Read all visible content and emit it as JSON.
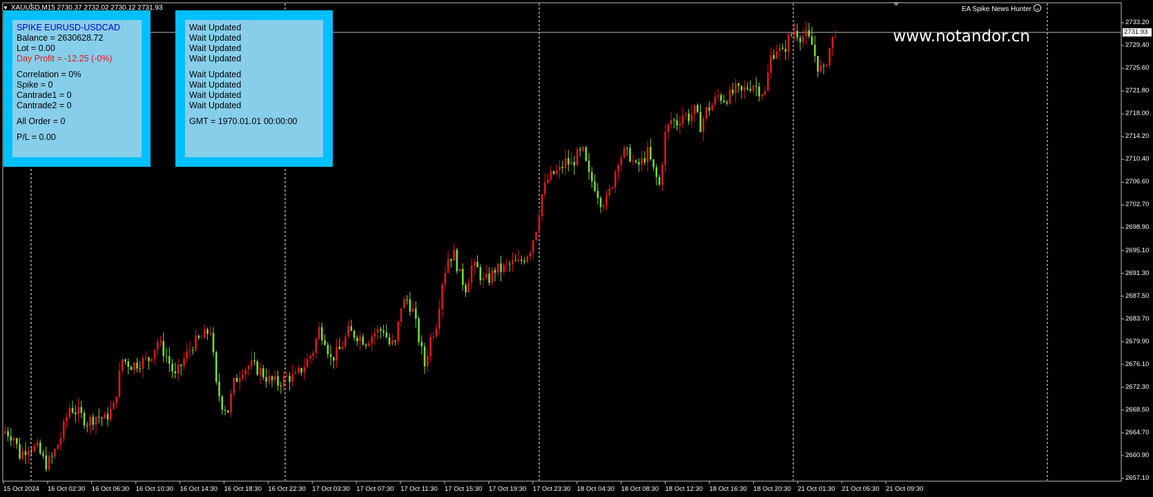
{
  "header": {
    "symbol_ohlc": "XAUUSD,M15  2730.37 2732.02 2730.12 2731.93",
    "ea_name": "EA Spike News Hunter",
    "watermark": "www.notandor.cn"
  },
  "colors": {
    "bull": "#E0171B",
    "bear": "#7BD83A",
    "panel_border": "#00BFFF",
    "panel_fill": "#87CEEB",
    "title_blue": "#0000CD",
    "profit_red": "#E0171B"
  },
  "panel_left": {
    "title": "SPIKE EURUSD-USDCAD",
    "balance": "Balance = 2630628.72",
    "lot": "Lot = 0.00",
    "day_profit": "Day Profit = -12.25 (-0%)",
    "correlation": "Correlation =  0%",
    "spike": "Spike = 0",
    "cantrade1": "Cantrade1 = 0",
    "cantrade2": "Cantrade2 = 0",
    "all_order": "All Order = 0",
    "pl": "P/L = 0.00"
  },
  "panel_right": {
    "status_lines": [
      "Wait Updated",
      "Wait Updated",
      "Wait Updated",
      "Wait Updated",
      "Wait Updated",
      "Wait Updated",
      "Wait Updated",
      "Wait Updated"
    ],
    "gmt": "GMT = 1970.01.01 00:00:00"
  },
  "chart_data": {
    "type": "candlestick",
    "symbol": "XAUUSD",
    "timeframe": "M15",
    "current_price": "2731.93",
    "ylim": [
      2657.1,
      2735.0
    ],
    "y_ticks": [
      "2733.20",
      "2729.40",
      "2725.60",
      "2721.80",
      "2718.00",
      "2714.20",
      "2710.40",
      "2706.60",
      "2702.70",
      "2698.90",
      "2695.10",
      "2691.30",
      "2687.50",
      "2683.70",
      "2679.90",
      "2676.10",
      "2672.30",
      "2668.50",
      "2664.70",
      "2660.90",
      "2657.10"
    ],
    "x_ticks": [
      "15 Oct 2024",
      "16 Oct 02:30",
      "16 Oct 06:30",
      "16 Oct 10:30",
      "16 Oct 14:30",
      "16 Oct 18:30",
      "16 Oct 22:30",
      "17 Oct 03:30",
      "17 Oct 07:30",
      "17 Oct 11:30",
      "17 Oct 15:30",
      "17 Oct 19:30",
      "17 Oct 23:30",
      "18 Oct 04:30",
      "18 Oct 08:30",
      "18 Oct 12:30",
      "18 Oct 16:30",
      "18 Oct 20:30",
      "21 Oct 01:30",
      "21 Oct 05:30",
      "21 Oct 09:30"
    ],
    "day_separators": [
      "16 Oct",
      "17 Oct",
      "18 Oct",
      "21 Oct"
    ],
    "close_path": [
      [
        0,
        2665.0
      ],
      [
        3,
        2664.0
      ],
      [
        5,
        2661.0
      ],
      [
        8,
        2662.5
      ],
      [
        11,
        2662.0
      ],
      [
        14,
        2659.5
      ],
      [
        16,
        2660.5
      ],
      [
        19,
        2664.0
      ],
      [
        22,
        2669.0
      ],
      [
        25,
        2668.0
      ],
      [
        28,
        2666.5
      ],
      [
        31,
        2667.5
      ],
      [
        34,
        2667.0
      ],
      [
        37,
        2669.0
      ],
      [
        40,
        2677.0
      ],
      [
        43,
        2676.0
      ],
      [
        46,
        2676.5
      ],
      [
        49,
        2677.0
      ],
      [
        52,
        2680.0
      ],
      [
        55,
        2677.5
      ],
      [
        58,
        2674.0
      ],
      [
        61,
        2677.0
      ],
      [
        64,
        2679.5
      ],
      [
        67,
        2680.5
      ],
      [
        70,
        2682.0
      ],
      [
        72,
        2672.5
      ],
      [
        74,
        2669.5
      ],
      [
        76,
        2668.5
      ],
      [
        78,
        2673.0
      ],
      [
        81,
        2675.5
      ],
      [
        84,
        2676.0
      ],
      [
        87,
        2675.0
      ],
      [
        90,
        2673.5
      ],
      [
        93,
        2673.0
      ],
      [
        96,
        2674.0
      ],
      [
        99,
        2674.0
      ],
      [
        102,
        2676.0
      ],
      [
        105,
        2678.5
      ],
      [
        107,
        2682.0
      ],
      [
        109,
        2680.5
      ],
      [
        111,
        2677.0
      ],
      [
        114,
        2678.5
      ],
      [
        117,
        2681.5
      ],
      [
        120,
        2681.0
      ],
      [
        123,
        2680.0
      ],
      [
        126,
        2681.5
      ],
      [
        129,
        2682.0
      ],
      [
        131,
        2679.5
      ],
      [
        133,
        2679.5
      ],
      [
        135,
        2686.0
      ],
      [
        137,
        2687.0
      ],
      [
        139,
        2685.0
      ],
      [
        141,
        2680.5
      ],
      [
        143,
        2676.0
      ],
      [
        145,
        2680.5
      ],
      [
        147,
        2683.0
      ],
      [
        149,
        2690.0
      ],
      [
        151,
        2694.0
      ],
      [
        153,
        2694.5
      ],
      [
        155,
        2691.0
      ],
      [
        157,
        2689.0
      ],
      [
        159,
        2692.5
      ],
      [
        161,
        2692.0
      ],
      [
        163,
        2690.0
      ],
      [
        165,
        2690.5
      ],
      [
        167,
        2692.0
      ],
      [
        169,
        2692.0
      ],
      [
        171,
        2692.5
      ],
      [
        173,
        2693.0
      ],
      [
        175,
        2693.0
      ],
      [
        177,
        2694.0
      ],
      [
        179,
        2695.5
      ],
      [
        181,
        2699.0
      ],
      [
        183,
        2704.5
      ],
      [
        185,
        2707.0
      ],
      [
        187,
        2708.0
      ],
      [
        189,
        2708.5
      ],
      [
        191,
        2710.0
      ],
      [
        193,
        2709.5
      ],
      [
        195,
        2711.0
      ],
      [
        197,
        2711.5
      ],
      [
        199,
        2707.5
      ],
      [
        201,
        2706.0
      ],
      [
        203,
        2703.5
      ],
      [
        205,
        2703.5
      ],
      [
        207,
        2706.5
      ],
      [
        209,
        2710.5
      ],
      [
        211,
        2711.5
      ],
      [
        213,
        2711.0
      ],
      [
        215,
        2709.0
      ],
      [
        217,
        2710.0
      ],
      [
        219,
        2711.5
      ],
      [
        221,
        2708.5
      ],
      [
        223,
        2706.0
      ],
      [
        225,
        2714.5
      ],
      [
        227,
        2717.0
      ],
      [
        229,
        2716.5
      ],
      [
        231,
        2718.0
      ],
      [
        233,
        2717.5
      ],
      [
        235,
        2718.5
      ],
      [
        237,
        2716.0
      ],
      [
        239,
        2718.5
      ],
      [
        241,
        2719.5
      ],
      [
        243,
        2721.0
      ],
      [
        245,
        2720.5
      ],
      [
        247,
        2721.0
      ],
      [
        249,
        2722.0
      ],
      [
        251,
        2721.5
      ],
      [
        253,
        2722.5
      ],
      [
        255,
        2723.0
      ],
      [
        257,
        2722.0
      ],
      [
        259,
        2721.5
      ],
      [
        261,
        2727.5
      ],
      [
        263,
        2729.0
      ],
      [
        265,
        2728.0
      ],
      [
        267,
        2730.5
      ],
      [
        269,
        2732.0
      ],
      [
        271,
        2731.0
      ],
      [
        273,
        2731.0
      ],
      [
        275,
        2729.5
      ],
      [
        277,
        2726.0
      ],
      [
        279,
        2725.0
      ],
      [
        281,
        2729.0
      ],
      [
        283,
        2731.93
      ]
    ]
  }
}
